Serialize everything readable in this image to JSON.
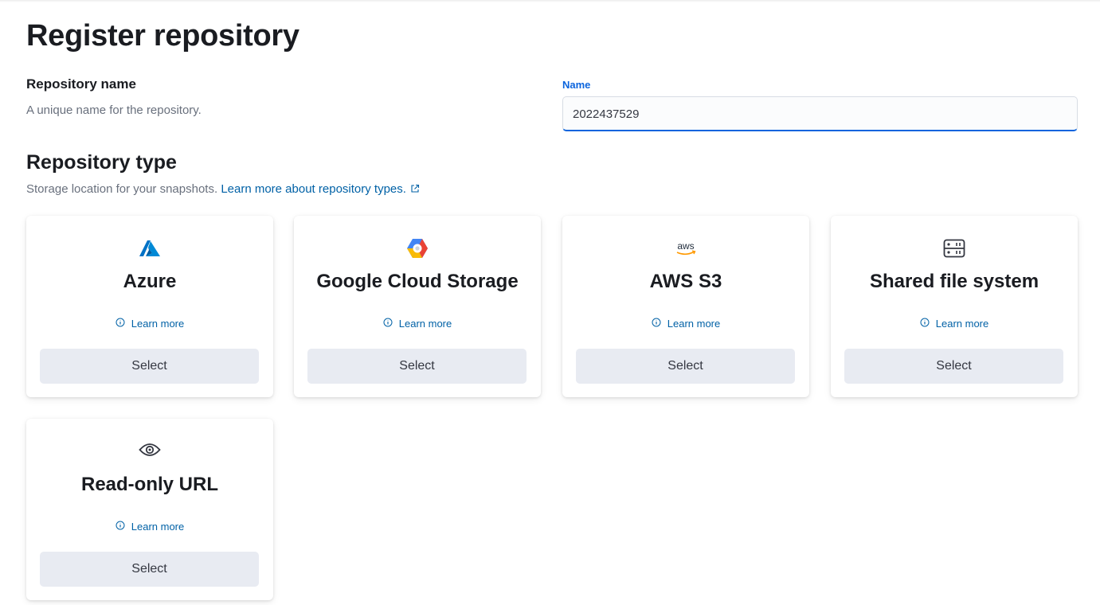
{
  "page": {
    "title": "Register repository"
  },
  "repository_name": {
    "heading": "Repository name",
    "description": "A unique name for the repository.",
    "field_label": "Name",
    "field_value": "2022437529"
  },
  "repository_type": {
    "heading": "Repository type",
    "description": "Storage location for your snapshots.",
    "link_text": "Learn more about repository types."
  },
  "cards": [
    {
      "title": "Azure",
      "icon": "azure-logo-icon",
      "learn_more": "Learn more",
      "button": "Select"
    },
    {
      "title": "Google Cloud Storage",
      "icon": "google-cloud-logo-icon",
      "learn_more": "Learn more",
      "button": "Select"
    },
    {
      "title": "AWS S3",
      "icon": "aws-logo-icon",
      "learn_more": "Learn more",
      "button": "Select"
    },
    {
      "title": "Shared file system",
      "icon": "storage-icon",
      "learn_more": "Learn more",
      "button": "Select"
    },
    {
      "title": "Read-only URL",
      "icon": "eye-icon",
      "learn_more": "Learn more",
      "button": "Select"
    }
  ],
  "colors": {
    "accent": "#0b64dd",
    "link": "#0061a6",
    "button_bg": "#e8ebf2",
    "text_subdued": "#69707d"
  }
}
